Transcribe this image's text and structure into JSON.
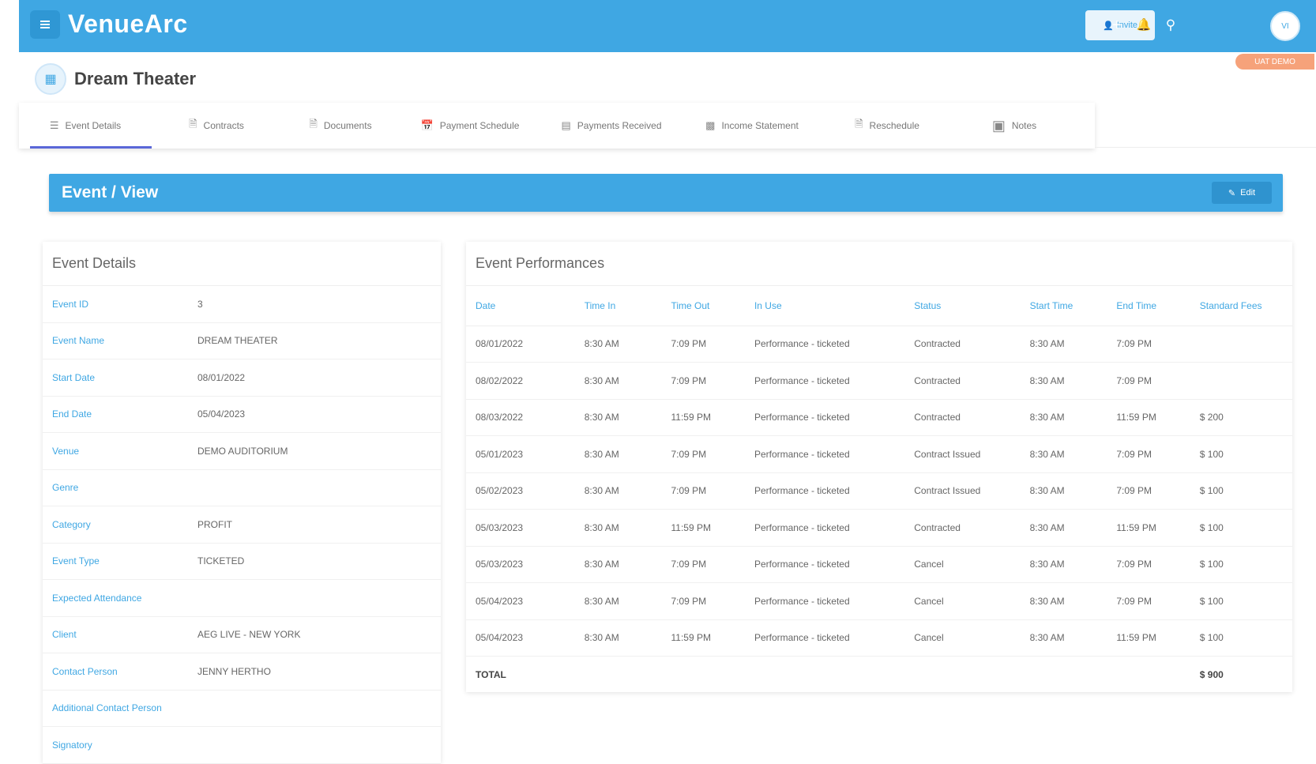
{
  "app": {
    "brand": "VenueArc"
  },
  "topbar": {
    "invite_label": "Invite",
    "avatar_initials": "VI",
    "env_badge": "UAT DEMO"
  },
  "header": {
    "venue_name": "Dream Theater"
  },
  "tabs": [
    {
      "label": "Event Details",
      "icon": "list-icon"
    },
    {
      "label": "Contracts",
      "icon": "file-icon"
    },
    {
      "label": "Documents",
      "icon": "document-icon"
    },
    {
      "label": "Payment Schedule",
      "icon": "calendar-icon"
    },
    {
      "label": "Payments Received",
      "icon": "payment-icon"
    },
    {
      "label": "Income Statement",
      "icon": "money-icon"
    },
    {
      "label": "Reschedule",
      "icon": "reschedule-icon"
    },
    {
      "label": "Notes",
      "icon": "notes-icon"
    }
  ],
  "view_bar": {
    "title": "Event / View",
    "edit_label": "Edit"
  },
  "details": {
    "title": "Event Details",
    "rows": [
      {
        "label": "Event ID",
        "value": "3"
      },
      {
        "label": "Event Name",
        "value": "DREAM THEATER"
      },
      {
        "label": "Start Date",
        "value": "08/01/2022"
      },
      {
        "label": "End Date",
        "value": "05/04/2023"
      },
      {
        "label": "Venue",
        "value": "DEMO AUDITORIUM"
      },
      {
        "label": "Genre",
        "value": ""
      },
      {
        "label": "Category",
        "value": "PROFIT"
      },
      {
        "label": "Event Type",
        "value": "TICKETED"
      },
      {
        "label": "Expected Attendance",
        "value": ""
      },
      {
        "label": "Client",
        "value": "AEG LIVE - NEW YORK"
      },
      {
        "label": "Contact Person",
        "value": "JENNY HERTHO"
      },
      {
        "label": "Additional Contact Person",
        "value": ""
      },
      {
        "label": "Signatory",
        "value": ""
      }
    ]
  },
  "performances": {
    "title": "Event Performances",
    "columns": [
      "Date",
      "Time In",
      "Time Out",
      "In Use",
      "Status",
      "Start Time",
      "End Time",
      "Standard Fees"
    ],
    "rows": [
      [
        "08/01/2022",
        "8:30 AM",
        "7:09 PM",
        "Performance - ticketed",
        "Contracted",
        "8:30 AM",
        "7:09 PM",
        ""
      ],
      [
        "08/02/2022",
        "8:30 AM",
        "7:09 PM",
        "Performance - ticketed",
        "Contracted",
        "8:30 AM",
        "7:09 PM",
        ""
      ],
      [
        "08/03/2022",
        "8:30 AM",
        "11:59 PM",
        "Performance - ticketed",
        "Contracted",
        "8:30 AM",
        "11:59 PM",
        "$ 200"
      ],
      [
        "05/01/2023",
        "8:30 AM",
        "7:09 PM",
        "Performance - ticketed",
        "Contract Issued",
        "8:30 AM",
        "7:09 PM",
        "$ 100"
      ],
      [
        "05/02/2023",
        "8:30 AM",
        "7:09 PM",
        "Performance - ticketed",
        "Contract Issued",
        "8:30 AM",
        "7:09 PM",
        "$ 100"
      ],
      [
        "05/03/2023",
        "8:30 AM",
        "11:59 PM",
        "Performance - ticketed",
        "Contracted",
        "8:30 AM",
        "11:59 PM",
        "$ 100"
      ],
      [
        "05/03/2023",
        "8:30 AM",
        "7:09 PM",
        "Performance - ticketed",
        "Cancel",
        "8:30 AM",
        "7:09 PM",
        "$ 100"
      ],
      [
        "05/04/2023",
        "8:30 AM",
        "7:09 PM",
        "Performance - ticketed",
        "Cancel",
        "8:30 AM",
        "7:09 PM",
        "$ 100"
      ],
      [
        "05/04/2023",
        "8:30 AM",
        "11:59 PM",
        "Performance - ticketed",
        "Cancel",
        "8:30 AM",
        "11:59 PM",
        "$ 100"
      ]
    ],
    "total_label": "TOTAL",
    "total_value": "$ 900"
  },
  "colors": {
    "brand": "#3fa7e3",
    "tab_active": "#5a67d8",
    "badge": "#f6a27a"
  }
}
